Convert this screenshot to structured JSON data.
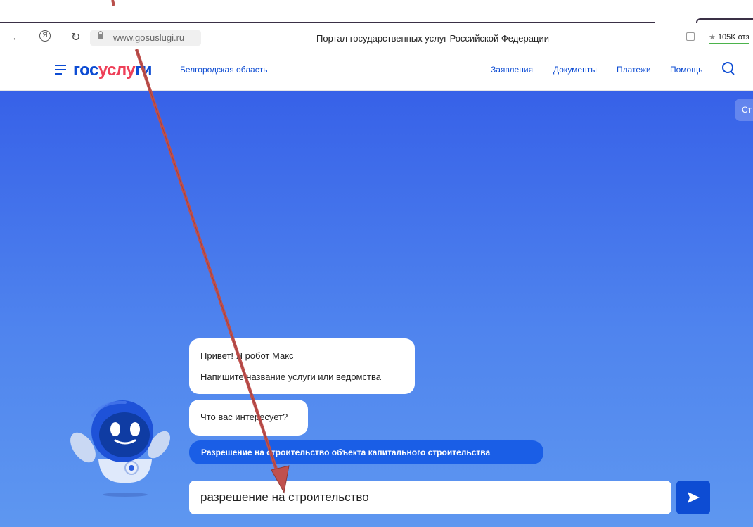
{
  "browser": {
    "url": "www.gosuslugi.ru",
    "title": "Портал государственных услуг Российской Федерации",
    "reviews": "105K отз",
    "reviews_star": "★"
  },
  "header": {
    "logo_part1": "гос",
    "logo_part2": "услу",
    "logo_part3": "ги",
    "region": "Белгородская область",
    "nav": [
      "Заявления",
      "Документы",
      "Платежи",
      "Помощь"
    ]
  },
  "hero": {
    "corner_button": "Ст"
  },
  "chat": {
    "greeting_line1": "Привет! Я робот Макс",
    "greeting_line2": "Напишите название услуги или ведомства",
    "question": "Что вас интересует?",
    "suggestion": "Разрешение на строительство объекта капитального строительства",
    "input_value": "разрешение на строительство"
  },
  "colors": {
    "brand_blue": "#0d4cd3",
    "brand_red": "#ee3f58",
    "annotation_arrow": "#c0504d"
  }
}
